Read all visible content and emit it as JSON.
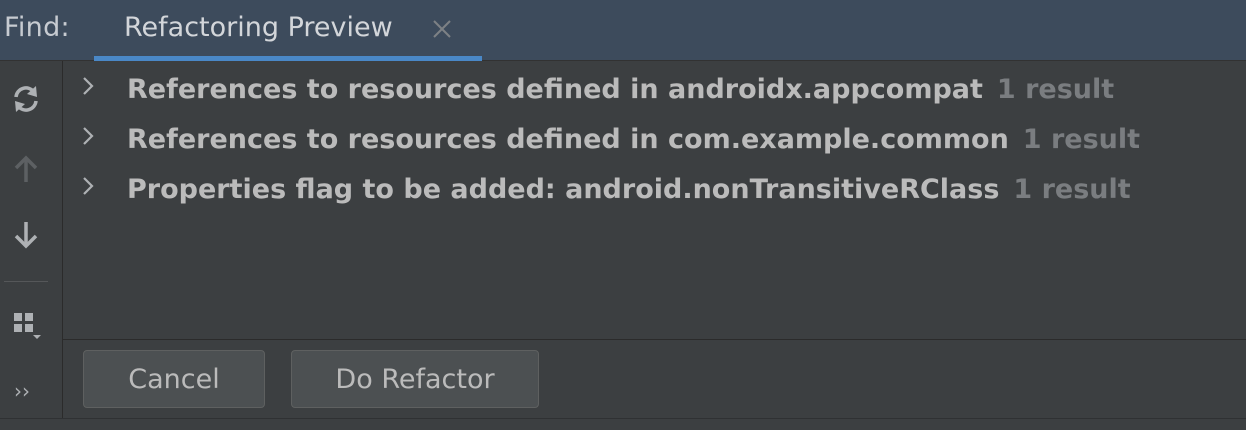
{
  "header": {
    "find_label": "Find:",
    "tab": {
      "label": "Refactoring Preview",
      "close_icon": "close-icon"
    }
  },
  "toolbar": {
    "items": [
      {
        "icon": "refresh-icon"
      },
      {
        "icon": "arrow-up-icon",
        "enabled": false
      },
      {
        "icon": "arrow-down-icon"
      },
      {
        "icon": "group-by-icon"
      }
    ],
    "more_label": "››"
  },
  "tree": {
    "rows": [
      {
        "label": "References to resources defined in androidx.appcompat",
        "count": "1 result"
      },
      {
        "label": "References to resources defined in com.example.common",
        "count": "1 result"
      },
      {
        "label": "Properties flag to be added: android.nonTransitiveRClass",
        "count": "1 result"
      }
    ]
  },
  "buttons": {
    "cancel": "Cancel",
    "do_refactor": "Do Refactor"
  },
  "colors": {
    "panel_bg": "#3c3f41",
    "header_bg": "#3d4b5c",
    "accent": "#4a88c7",
    "text": "#bbbbbb",
    "muted": "#7a7d80"
  }
}
